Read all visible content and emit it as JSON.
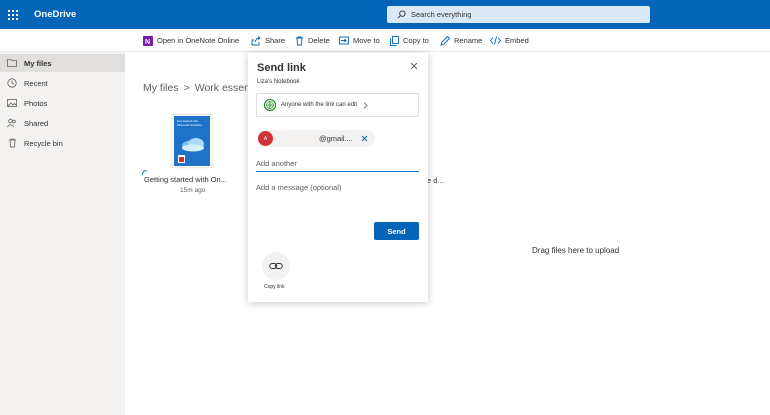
{
  "app": {
    "brand": "OneDrive",
    "search_placeholder": "Search everything"
  },
  "commands": [
    {
      "label": "Open in OneNote Online",
      "icon": "onenote-icon"
    },
    {
      "label": "Share",
      "icon": "share-icon"
    },
    {
      "label": "Delete",
      "icon": "delete-icon"
    },
    {
      "label": "Move to",
      "icon": "move-to-icon"
    },
    {
      "label": "Copy to",
      "icon": "copy-to-icon"
    },
    {
      "label": "Rename",
      "icon": "rename-icon"
    },
    {
      "label": "Embed",
      "icon": "embed-icon"
    }
  ],
  "nav": [
    {
      "label": "My files",
      "icon": "folder-icon",
      "active": true
    },
    {
      "label": "Recent",
      "icon": "clock-icon"
    },
    {
      "label": "Photos",
      "icon": "photo-icon"
    },
    {
      "label": "Shared",
      "icon": "people-icon"
    },
    {
      "label": "Recycle bin",
      "icon": "recycle-bin-icon"
    }
  ],
  "breadcrumb": {
    "root": "My files",
    "separator": ">",
    "current": "Work essen"
  },
  "file": {
    "name": "Getting started with On...",
    "time": "15m ago",
    "thumbnail_title": "Get started with Microsoft OneNote"
  },
  "behind_dialog_text": "e d...",
  "drag_hint": "Drag files here to upload",
  "dialog": {
    "title": "Send link",
    "subtitle": "Liza's Notebook",
    "permission": "Anyone with the link can edit",
    "recipient_initial": "A",
    "recipient_email": "@gmail....",
    "add_another_placeholder": "Add another",
    "message_placeholder": "Add a message (optional)",
    "send_label": "Send",
    "copy_link_label": "Copy link"
  },
  "colors": {
    "brand_blue": "#0364b8",
    "search_bg": "#dbe8f7",
    "nav_bg": "#f3f2f1",
    "avatar_red": "#d13438",
    "globe_green": "#107c10",
    "onenote_purple": "#7719aa"
  }
}
